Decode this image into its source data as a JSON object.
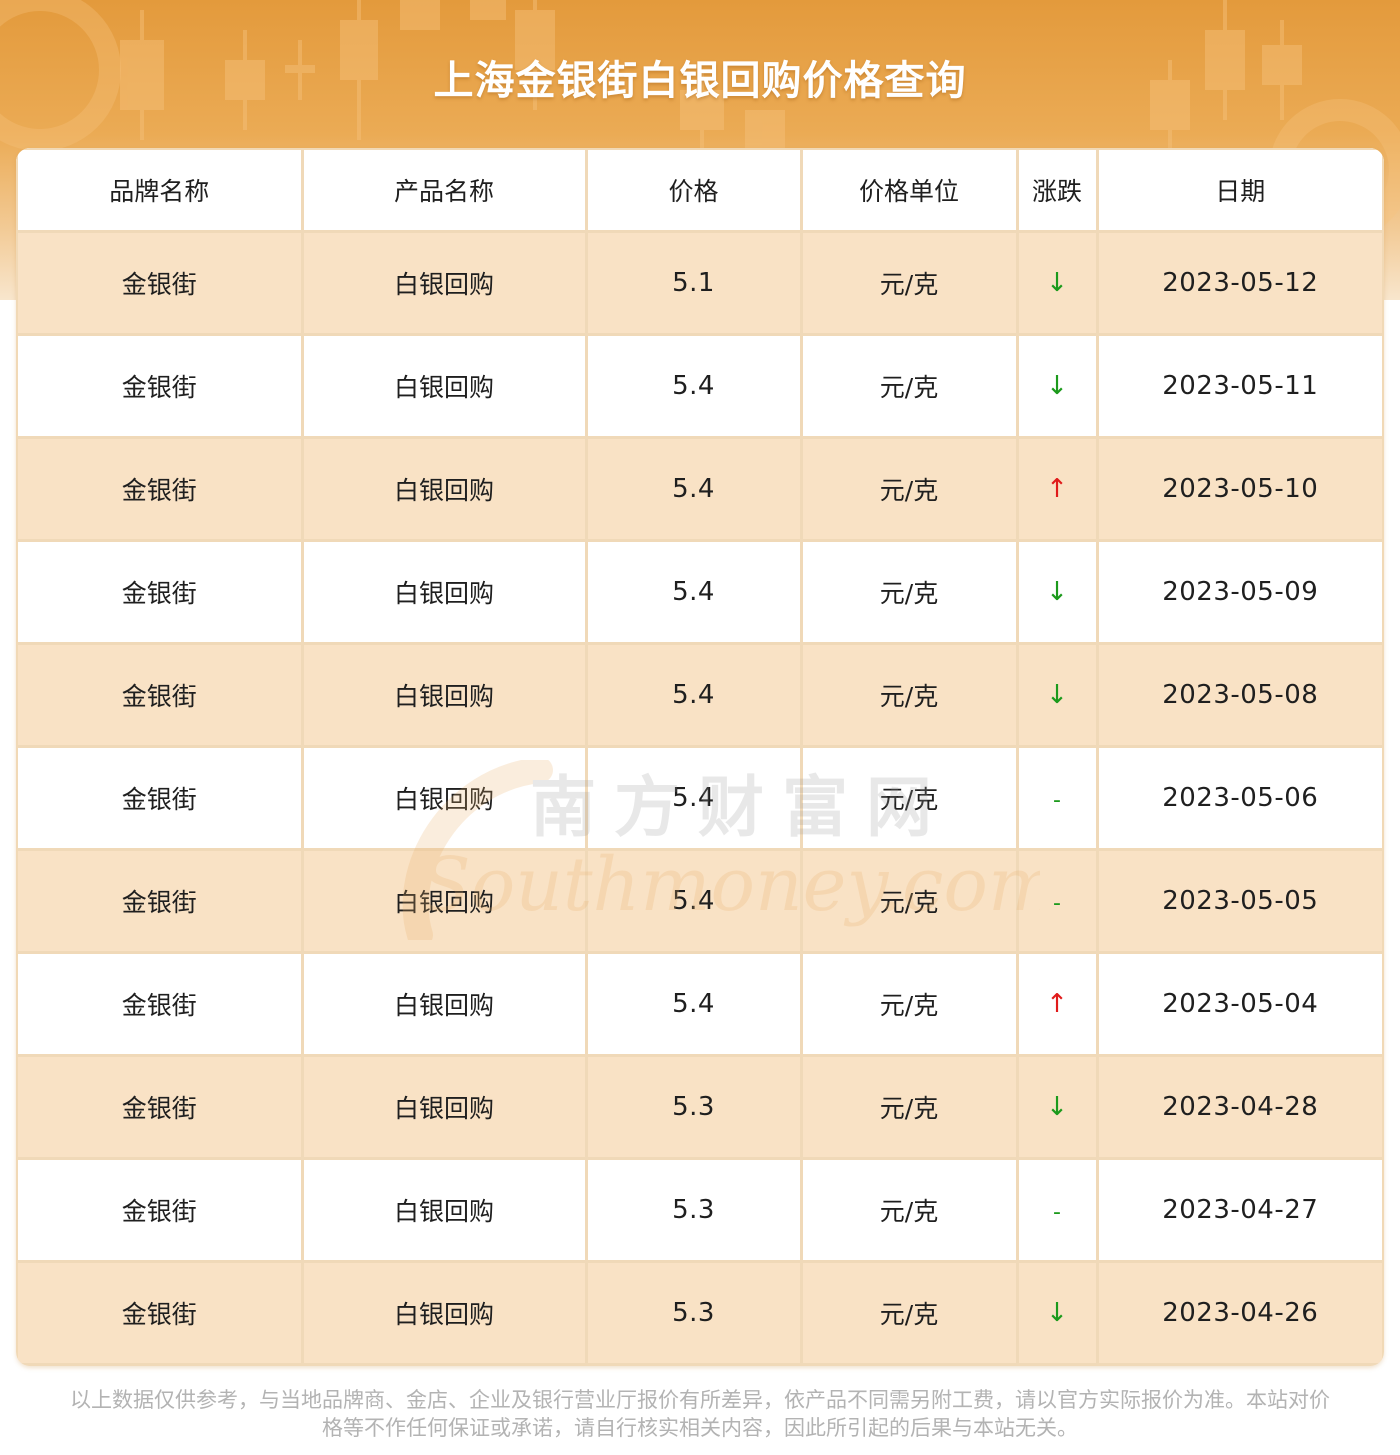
{
  "header": {
    "title": "上海金银街白银回购价格查询"
  },
  "table": {
    "columns": [
      "品牌名称",
      "产品名称",
      "价格",
      "价格单位",
      "涨跌",
      "日期"
    ],
    "rows": [
      {
        "brand": "金银街",
        "product": "白银回购",
        "price": "5.1",
        "unit": "元/克",
        "change": "↓",
        "trend": "down",
        "date": "2023-05-12"
      },
      {
        "brand": "金银街",
        "product": "白银回购",
        "price": "5.4",
        "unit": "元/克",
        "change": "↓",
        "trend": "down",
        "date": "2023-05-11"
      },
      {
        "brand": "金银街",
        "product": "白银回购",
        "price": "5.4",
        "unit": "元/克",
        "change": "↑",
        "trend": "up",
        "date": "2023-05-10"
      },
      {
        "brand": "金银街",
        "product": "白银回购",
        "price": "5.4",
        "unit": "元/克",
        "change": "↓",
        "trend": "down",
        "date": "2023-05-09"
      },
      {
        "brand": "金银街",
        "product": "白银回购",
        "price": "5.4",
        "unit": "元/克",
        "change": "↓",
        "trend": "down",
        "date": "2023-05-08"
      },
      {
        "brand": "金银街",
        "product": "白银回购",
        "price": "5.4",
        "unit": "元/克",
        "change": "-",
        "trend": "flat",
        "date": "2023-05-06"
      },
      {
        "brand": "金银街",
        "product": "白银回购",
        "price": "5.4",
        "unit": "元/克",
        "change": "-",
        "trend": "flat",
        "date": "2023-05-05"
      },
      {
        "brand": "金银街",
        "product": "白银回购",
        "price": "5.4",
        "unit": "元/克",
        "change": "↑",
        "trend": "up",
        "date": "2023-05-04"
      },
      {
        "brand": "金银街",
        "product": "白银回购",
        "price": "5.3",
        "unit": "元/克",
        "change": "↓",
        "trend": "down",
        "date": "2023-04-28"
      },
      {
        "brand": "金银街",
        "product": "白银回购",
        "price": "5.3",
        "unit": "元/克",
        "change": "-",
        "trend": "flat",
        "date": "2023-04-27"
      },
      {
        "brand": "金银街",
        "product": "白银回购",
        "price": "5.3",
        "unit": "元/克",
        "change": "↓",
        "trend": "down",
        "date": "2023-04-26"
      }
    ]
  },
  "watermark": {
    "cn": "南方财富网",
    "en": "Southmoney.com"
  },
  "footer": {
    "disclaimer": "以上数据仅供参考，与当地品牌商、金店、企业及银行营业厅报价有所差异，依产品不同需另附工费，请以官方实际报价为准。本站对价格等不作任何保证或承诺，请自行核实相关内容，因此所引起的后果与本站无关。"
  },
  "colors": {
    "banner_top": "#e39a3c",
    "row_highlight": "#f9e2c5",
    "grid_line": "#f0d9b8",
    "trend_down": "#1c9a1c",
    "trend_up": "#e01b1b"
  }
}
